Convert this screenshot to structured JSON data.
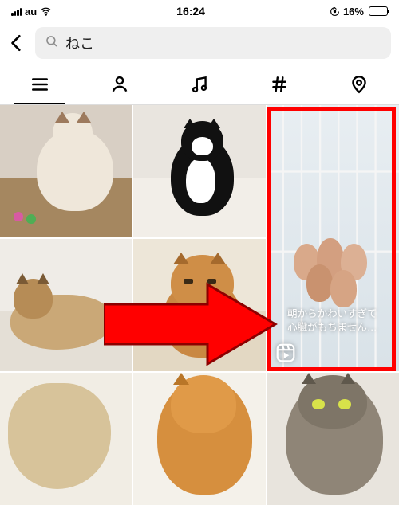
{
  "status": {
    "carrier": "au",
    "time": "16:24",
    "battery_pct": "16%"
  },
  "search": {
    "query": "ねこ"
  },
  "reels": {
    "caption_line1": "朝からかわいすぎて",
    "caption_line2": "心臓がもちません…"
  },
  "colors": {
    "accent_red": "#ff0000",
    "battery_low": "#ff3b30"
  }
}
